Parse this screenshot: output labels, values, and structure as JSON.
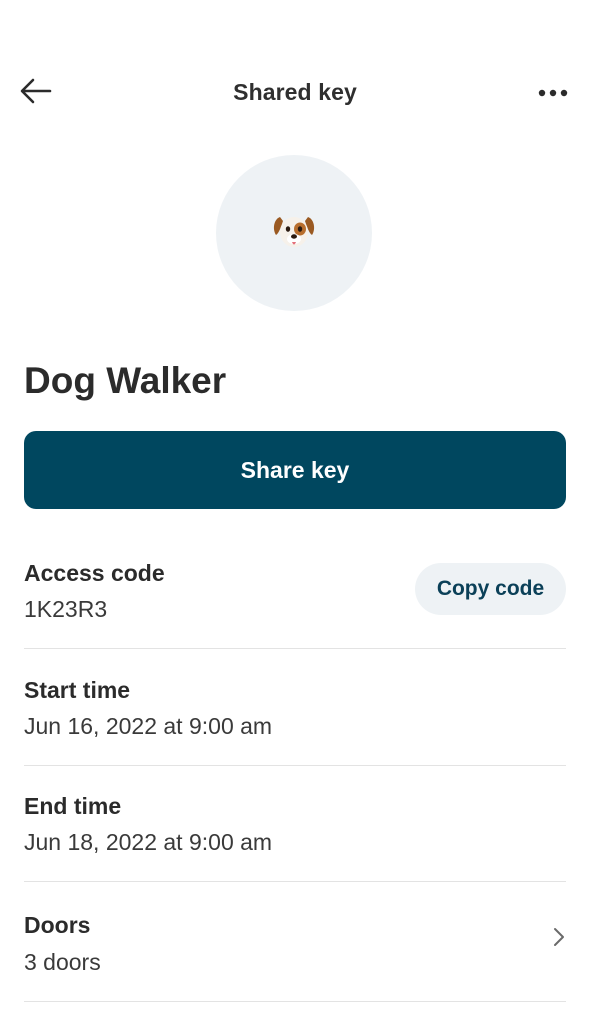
{
  "header": {
    "title": "Shared key",
    "back_icon": "arrow-left-icon",
    "more_icon": "more-horizontal-icon"
  },
  "avatar": {
    "icon": "dog-face-icon",
    "emoji": "🐶"
  },
  "key": {
    "name": "Dog Walker",
    "share_label": "Share key"
  },
  "details": {
    "access_code": {
      "label": "Access code",
      "value": "1K23R3",
      "copy_label": "Copy code"
    },
    "start_time": {
      "label": "Start time",
      "value": "Jun 16, 2022 at 9:00 am"
    },
    "end_time": {
      "label": "End time",
      "value": "Jun 18, 2022 at 9:00 am"
    },
    "doors": {
      "label": "Doors",
      "value": "3 doors",
      "chevron_icon": "chevron-right-icon"
    }
  },
  "colors": {
    "primary": "#00475f",
    "secondary_bg": "#eef2f5",
    "text": "#2b2b2b",
    "divider": "#e3e3e3"
  }
}
